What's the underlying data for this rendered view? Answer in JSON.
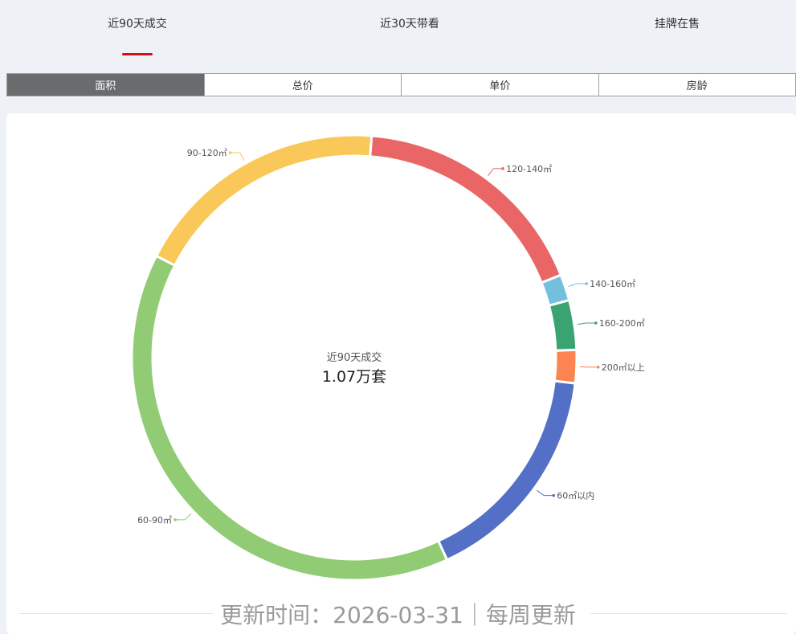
{
  "tabs": [
    "近90天成交",
    "近30天带看",
    "挂牌在售"
  ],
  "active_tab": 0,
  "segments": [
    "面积",
    "总价",
    "单价",
    "房龄"
  ],
  "active_segment": 0,
  "center": {
    "subtitle": "近90天成交",
    "value": "1.07万套"
  },
  "footer": "更新时间：2026-03-31｜每周更新",
  "colors": {
    "tab_underline": "#d0111b",
    "segment_active": "#6a6b6d"
  },
  "chart_data": {
    "type": "pie",
    "subtype": "donut",
    "categories": [
      "120-140㎡",
      "140-160㎡",
      "160-200㎡",
      "200㎡以上",
      "60㎡以内",
      "60-90㎡",
      "90-120㎡"
    ],
    "values": [
      17.7,
      1.9,
      3.6,
      2.4,
      16.3,
      39.4,
      18.7
    ],
    "colors": [
      "#ea6666",
      "#73c0de",
      "#3ba272",
      "#fc8452",
      "#5470c6",
      "#91cc75",
      "#fac858"
    ]
  }
}
